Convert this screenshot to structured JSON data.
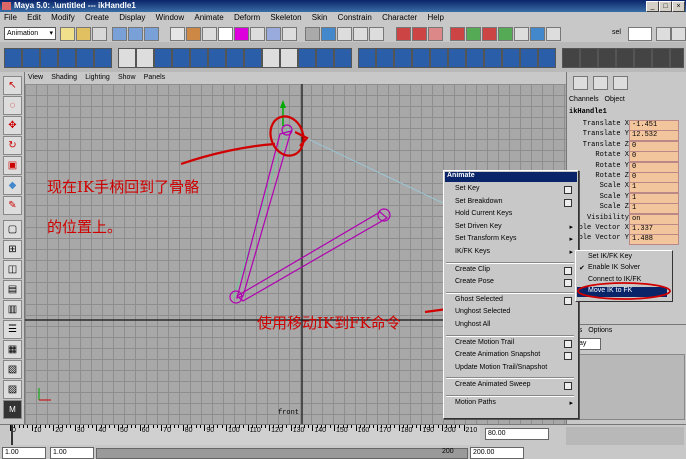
{
  "window": {
    "title": "Maya 5.0: .\\untitled   ---   ikHandle1"
  },
  "menubar": [
    "File",
    "Edit",
    "Modify",
    "Create",
    "Display",
    "Window",
    "Animate",
    "Deform",
    "Skeleton",
    "Skin",
    "Constrain",
    "Character",
    "Help"
  ],
  "statusline": {
    "mode": "Animation",
    "sel_label": "sel"
  },
  "panel_menu": [
    "View",
    "Shading",
    "Lighting",
    "Show",
    "Panels"
  ],
  "viewport": {
    "camera_label": "front"
  },
  "channelbox": {
    "tabs": [
      "Channels",
      "Object"
    ],
    "node": "ikHandle1",
    "channels": [
      {
        "name": "Translate X",
        "value": "-1.451"
      },
      {
        "name": "Translate Y",
        "value": "12.532"
      },
      {
        "name": "Translate Z",
        "value": "0"
      },
      {
        "name": "Rotate X",
        "value": "0"
      },
      {
        "name": "Rotate Y",
        "value": "0"
      },
      {
        "name": "Rotate Z",
        "value": "0"
      },
      {
        "name": "Scale X",
        "value": "1"
      },
      {
        "name": "Scale Y",
        "value": "1"
      },
      {
        "name": "Scale Z",
        "value": "1"
      },
      {
        "name": "Visibility",
        "value": "on"
      },
      {
        "name": "ole Vector X",
        "value": "1.337"
      },
      {
        "name": "ole Vector Y",
        "value": "1.488"
      }
    ],
    "solver_label": "ikRPsolver",
    "layer_tabs": [
      "yers",
      "Options"
    ],
    "layer_dropdown": "splay"
  },
  "animate_menu": {
    "title": "Animate",
    "items": [
      {
        "label": "Set Key",
        "option": true
      },
      {
        "label": "Set Breakdown",
        "option": true
      },
      {
        "label": "Hold Current Keys",
        "option": false
      },
      {
        "label": "Set Driven Key",
        "arrow": true
      },
      {
        "label": "Set Transform Keys",
        "arrow": true
      },
      {
        "label": "IK/FK Keys",
        "arrow": true
      },
      {
        "label": "Create Clip",
        "option": true
      },
      {
        "label": "Create Pose",
        "option": true
      },
      {
        "label": "Ghost Selected",
        "option": true
      },
      {
        "label": "Unghost Selected",
        "option": false
      },
      {
        "label": "Unghost All",
        "option": false
      },
      {
        "label": "Create Motion Trail",
        "option": true
      },
      {
        "label": "Create Animation Snapshot",
        "option": true
      },
      {
        "label": "Update Motion Trail/Snapshot",
        "option": false
      },
      {
        "label": "Create Animated Sweep",
        "option": true
      },
      {
        "label": "Motion Paths",
        "arrow": true
      }
    ]
  },
  "ikfk_submenu": {
    "items": [
      "Set IK/FK Key",
      "Enable IK Solver",
      "Connect to IK/FK",
      "Move IK to FK"
    ],
    "checked": "Enable IK Solver",
    "highlighted": "Move IK to FK"
  },
  "annotations": {
    "line1": "现在IK手柄回到了骨骼",
    "line2": "的位置上。",
    "line3": "使用移动IK到FK命令"
  },
  "timeslider": {
    "ticks": [
      "0",
      "10",
      "20",
      "30",
      "40",
      "50",
      "60",
      "70",
      "80",
      "90",
      "100",
      "110",
      "120",
      "130",
      "140",
      "150",
      "160",
      "170",
      "180",
      "190",
      "200",
      "210"
    ],
    "current_frame": "1.00",
    "range_end_1": "80.00",
    "range_end_2": "200.00",
    "range_start_1": "1.00",
    "range_start_2": "1.00",
    "ruler_end": "200"
  },
  "colors": {
    "annotation": "#d00000",
    "menu_highlight": "#0a246a",
    "channel_value_bg": "#f3c59d",
    "bone": "#b000b0"
  }
}
